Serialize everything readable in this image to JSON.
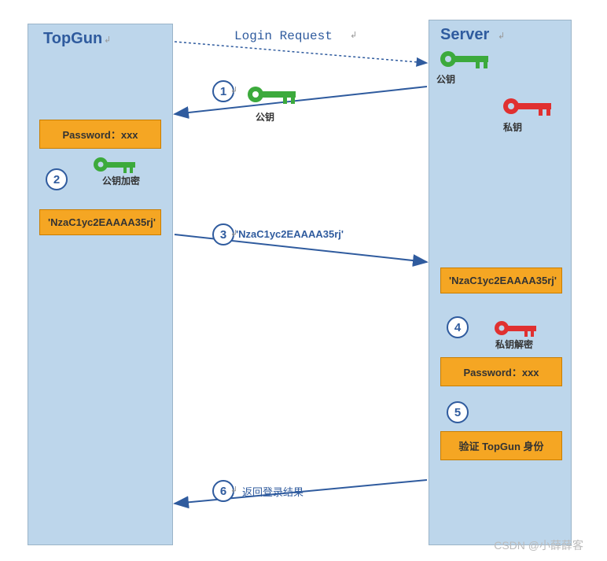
{
  "client": {
    "title": "TopGun"
  },
  "server": {
    "title": "Server"
  },
  "login_request": "Login Request",
  "password_box": "Password：xxx",
  "encrypted_box": "'NzaC1yc2EAAAA35rj'",
  "verify_box": "验证 TopGun 身份",
  "steps": {
    "s1": "1",
    "s2": "2",
    "s3": "3",
    "s4": "4",
    "s5": "5",
    "s6": "6"
  },
  "msg_encrypted": "'NzaC1yc2EAAAA35rj'",
  "return_result": "返回登录结果",
  "keys": {
    "public": "公钥",
    "private": "私钥",
    "public_encrypt": "公钥加密",
    "private_decrypt": "私钥解密"
  },
  "watermark": "CSDN @小薛薛客",
  "colors": {
    "green": "#3caa3c",
    "red": "#e03030",
    "blue": "#2f5b9e",
    "orange": "#f5a623"
  }
}
